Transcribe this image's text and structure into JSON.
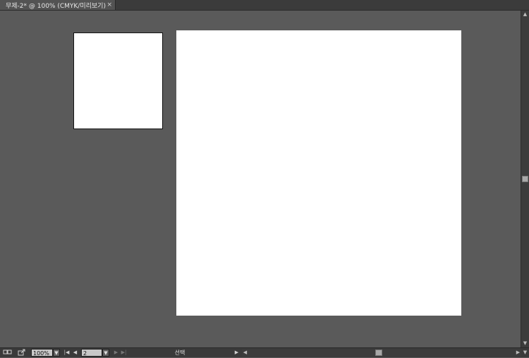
{
  "tab": {
    "title": "무제-2* @ 100% (CMYK/미리보기)",
    "close_glyph": "×"
  },
  "statusbar": {
    "zoom_value": "100%",
    "artboard_value": "2",
    "status_label": "선택",
    "icons": {
      "left_icon": "artboard-icon",
      "share_icon": "share-icon"
    }
  },
  "colors": {
    "canvas_bg": "#5a5a5a",
    "artboard_fill": "#ffffff",
    "chrome_dark": "#3a3a3a"
  }
}
